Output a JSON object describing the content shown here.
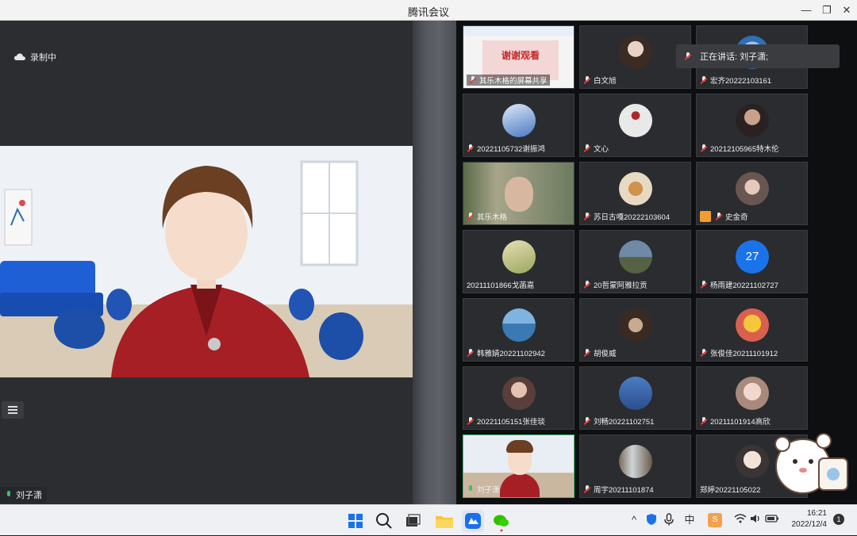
{
  "window": {
    "title": "腾讯会议"
  },
  "recording": {
    "label": "录制中"
  },
  "speaker": {
    "name": "刘子潇"
  },
  "speaking_now": {
    "text": "正在讲话: 刘子潇;"
  },
  "share_tile": {
    "banner": "谢谢观看",
    "label": "其乐木格的屏幕共享"
  },
  "participants": [
    {
      "name": "白文旭"
    },
    {
      "name": "宏齐20222103161"
    },
    {
      "name": "20221105732谢振鸿"
    },
    {
      "name": "文心"
    },
    {
      "name": "20212105965特木伦"
    },
    {
      "name": "其乐木格"
    },
    {
      "name": "苏日古嘎20222103604"
    },
    {
      "name": "史金奇"
    },
    {
      "name": "20211101866戈菡嘉"
    },
    {
      "name": "20哲蒙阿雅拉贡"
    },
    {
      "name": "杨雨建20221102727"
    },
    {
      "name": "韩雅婧20221102942"
    },
    {
      "name": "胡俊威"
    },
    {
      "name": "张俊佳20211101912"
    },
    {
      "name": "20221105151张佳琰"
    },
    {
      "name": "刘畅20221102751"
    },
    {
      "name": "20211101914高欣"
    },
    {
      "name": "刘子潇"
    },
    {
      "name": "周宇20211101874"
    },
    {
      "name": "郑婷20221105022"
    }
  ],
  "number_avatar": {
    "value": "27"
  },
  "taskbar": {
    "clock_time": "16:21",
    "clock_date": "2022/12/4",
    "notifications": "1",
    "ime": "中"
  },
  "colors": {
    "accent_blue": "#1a73e8",
    "mic_green": "#39c26b",
    "muted_red": "#e53935"
  }
}
